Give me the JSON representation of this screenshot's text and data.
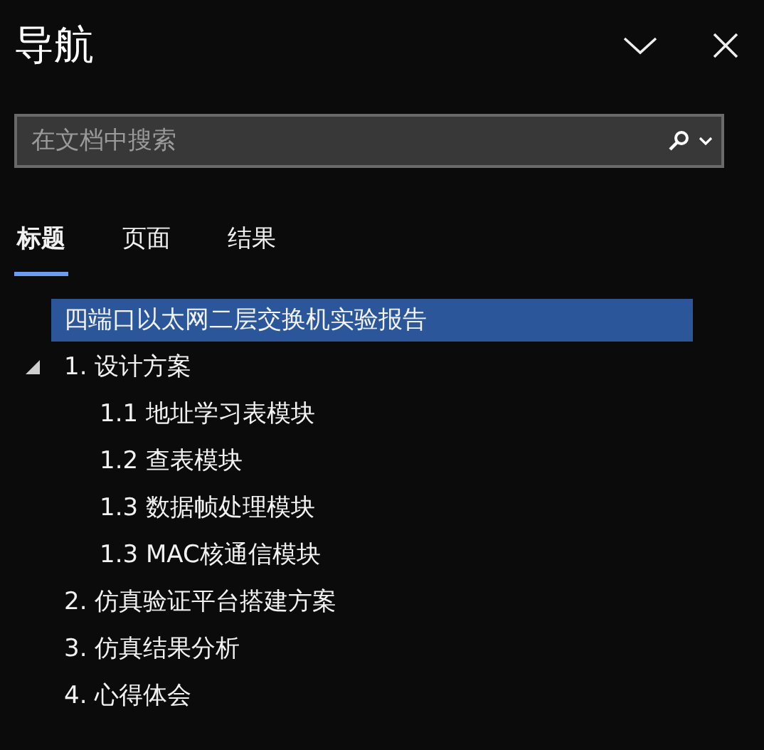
{
  "pane": {
    "title": "导航"
  },
  "search": {
    "placeholder": "在文档中搜索"
  },
  "tabs": [
    {
      "label": "标题",
      "selected": true
    },
    {
      "label": "页面",
      "selected": false
    },
    {
      "label": "结果",
      "selected": false
    }
  ],
  "outline": [
    {
      "label": "四端口以太网二层交换机实验报告",
      "selected": true
    },
    {
      "label": "1. 设计方案",
      "selected": false,
      "expanded": true,
      "children": [
        {
          "label": "1.1 地址学习表模块",
          "selected": false
        },
        {
          "label": "1.2 查表模块",
          "selected": false
        },
        {
          "label": "1.3 数据帧处理模块",
          "selected": false
        },
        {
          "label": "1.3 MAC核通信模块",
          "selected": false
        }
      ]
    },
    {
      "label": "2. 仿真验证平台搭建方案",
      "selected": false
    },
    {
      "label": "3. 仿真结果分析",
      "selected": false
    },
    {
      "label": "4. 心得体会",
      "selected": false
    }
  ]
}
